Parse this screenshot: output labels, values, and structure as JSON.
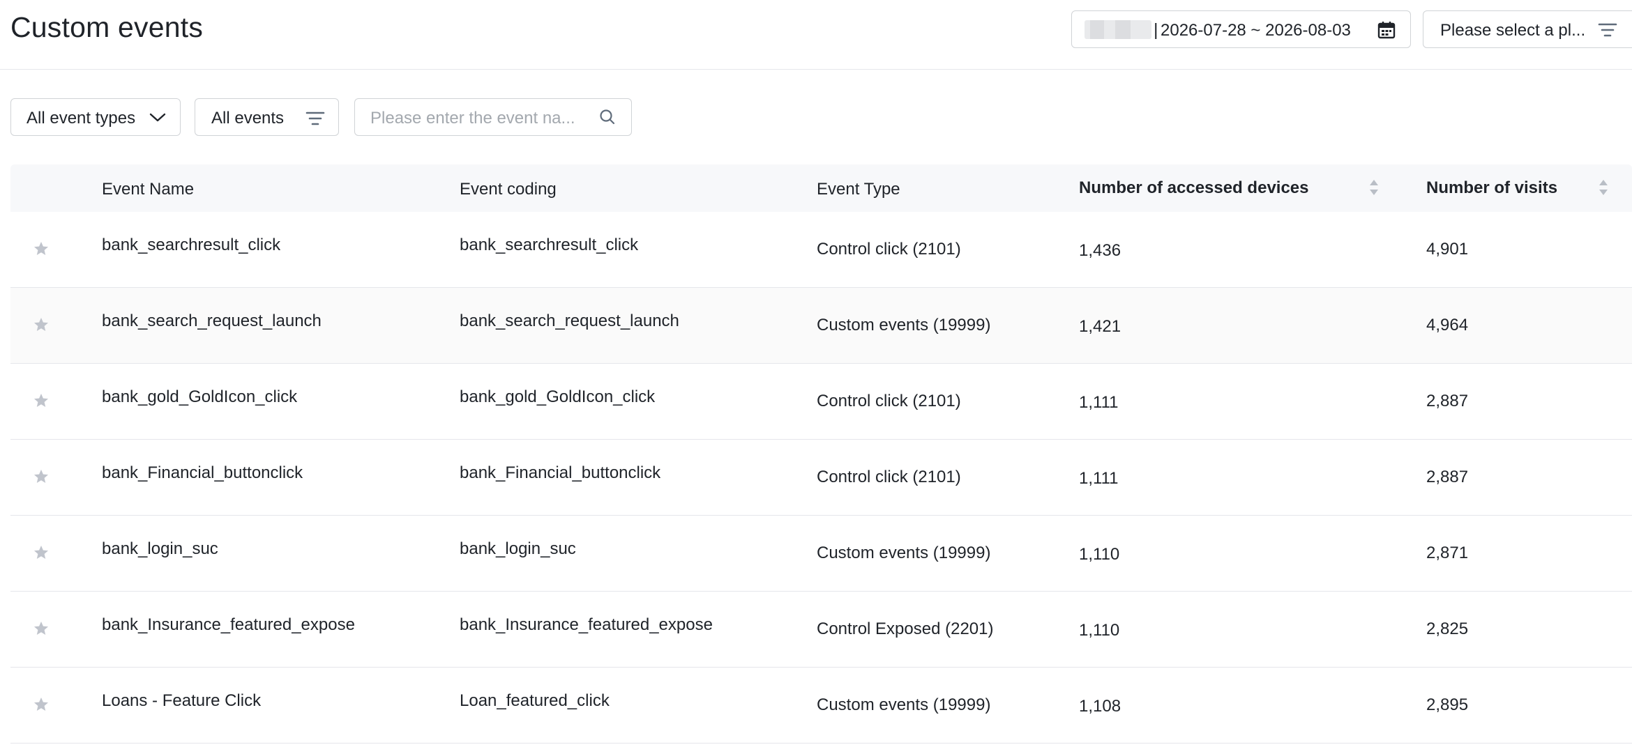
{
  "header": {
    "title": "Custom events",
    "date_range": "2026-07-28 ~ 2026-08-03",
    "date_separator": "|",
    "platform_placeholder": "Please select a pl..."
  },
  "filters": {
    "event_types": "All event types",
    "events": "All events",
    "search_placeholder": "Please enter the event na..."
  },
  "table": {
    "columns": {
      "event_name": "Event Name",
      "event_coding": "Event coding",
      "event_type": "Event Type",
      "accessed_devices": "Number of accessed devices",
      "visits": "Number of visits"
    },
    "rows": [
      {
        "name": "bank_searchresult_click",
        "coding": "bank_searchresult_click",
        "type": "Control click (2101)",
        "devices": "1,436",
        "visits": "4,901"
      },
      {
        "name": "bank_search_request_launch",
        "coding": "bank_search_request_launch",
        "type": "Custom events (19999)",
        "devices": "1,421",
        "visits": "4,964"
      },
      {
        "name": "bank_gold_GoldIcon_click",
        "coding": "bank_gold_GoldIcon_click",
        "type": "Control click (2101)",
        "devices": "1,111",
        "visits": "2,887"
      },
      {
        "name": "bank_Financial_buttonclick",
        "coding": "bank_Financial_buttonclick",
        "type": "Control click (2101)",
        "devices": "1,111",
        "visits": "2,887"
      },
      {
        "name": "bank_login_suc",
        "coding": "bank_login_suc",
        "type": "Custom events (19999)",
        "devices": "1,110",
        "visits": "2,871"
      },
      {
        "name": "bank_Insurance_featured_expose",
        "coding": "bank_Insurance_featured_expose",
        "type": "Control Exposed (2201)",
        "devices": "1,110",
        "visits": "2,825"
      },
      {
        "name": "Loans - Feature Click",
        "coding": "Loan_featured_click",
        "type": "Custom events (19999)",
        "devices": "1,108",
        "visits": "2,895"
      }
    ]
  },
  "icons": {
    "calendar": "calendar-icon",
    "filter": "filter-lines-icon",
    "chevron": "chevron-down-icon",
    "search": "search-icon",
    "star": "star-icon",
    "sort": "sort-icon"
  },
  "colors": {
    "text": "#1f2329",
    "muted": "#a3a8ae",
    "border": "#d0d3d6",
    "star": "#c0c4cc",
    "header_bg": "#f7f8fa"
  }
}
